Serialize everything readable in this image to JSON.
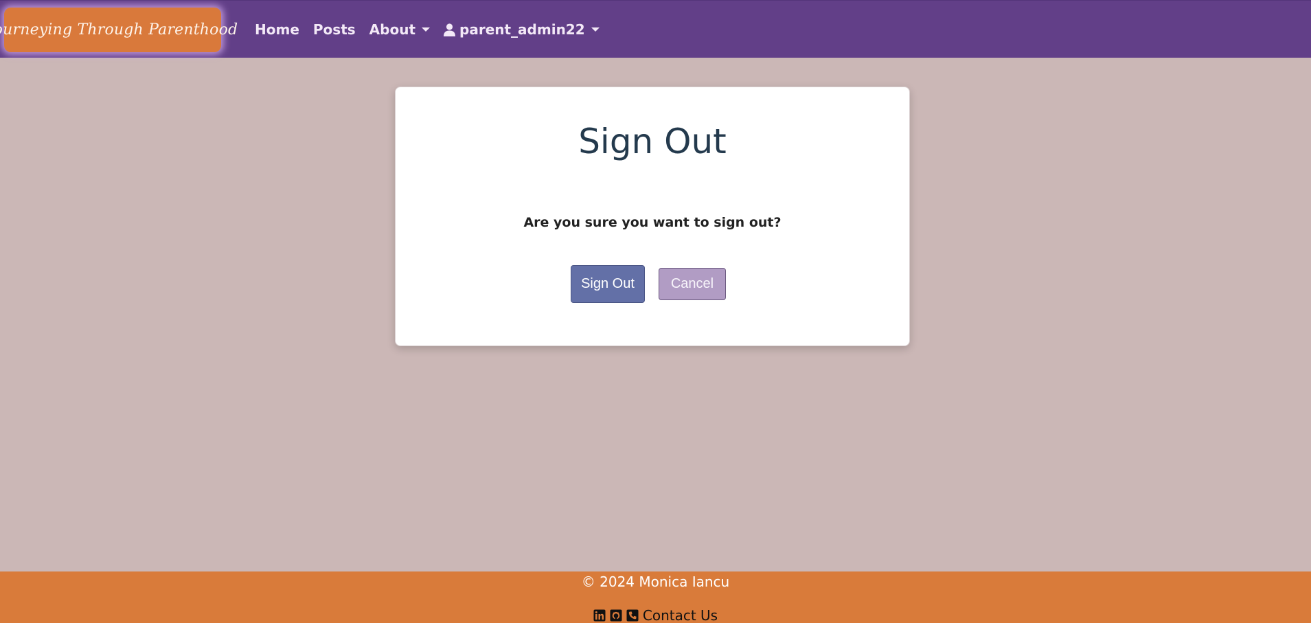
{
  "navbar": {
    "brand": "Journeying Through Parenthood",
    "links": {
      "home": "Home",
      "posts": "Posts",
      "about": "About",
      "user": "parent_admin22"
    }
  },
  "dialog": {
    "title": "Sign Out",
    "question": "Are you sure you want to sign out?",
    "confirm_label": "Sign Out",
    "cancel_label": "Cancel"
  },
  "footer": {
    "copyright": "© 2024 Monica Iancu",
    "contact_label": "Contact Us",
    "icons": [
      "linkedin-icon",
      "github-icon",
      "phone-icon"
    ]
  },
  "colors": {
    "navbar": "#623f88",
    "brand_bg": "#d9793b",
    "page_bg": "#cbb7b6",
    "footer_bg": "#d97b3a",
    "primary_button": "#6370a7",
    "secondary_button": "#b19cc4"
  }
}
